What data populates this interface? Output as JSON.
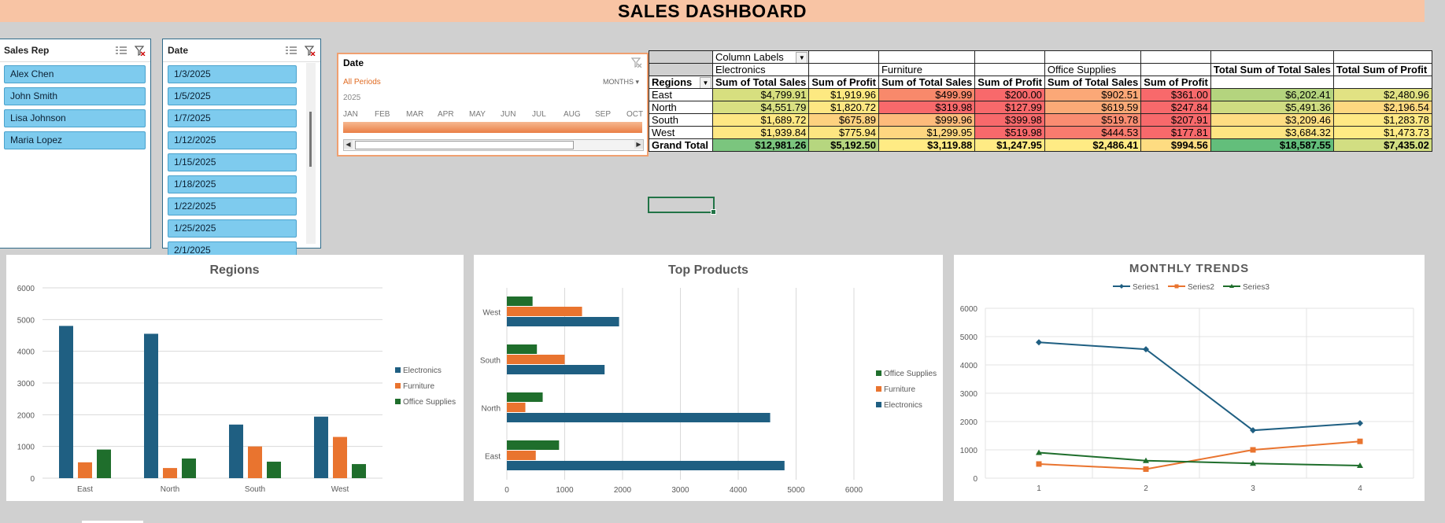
{
  "dashboard": {
    "title": "SALES DASHBOARD"
  },
  "slicers": {
    "sales_rep": {
      "title": "Sales Rep",
      "items": [
        "Alex Chen",
        "John Smith",
        "Lisa Johnson",
        "Maria Lopez"
      ]
    },
    "date": {
      "title": "Date",
      "items": [
        "1/3/2025",
        "1/5/2025",
        "1/7/2025",
        "1/12/2025",
        "1/15/2025",
        "1/18/2025",
        "1/22/2025",
        "1/25/2025",
        "2/1/2025"
      ]
    }
  },
  "timeline": {
    "title": "Date",
    "all_periods": "All Periods",
    "level": "MONTHS",
    "year": "2025",
    "months": [
      "JAN",
      "FEB",
      "MAR",
      "APR",
      "MAY",
      "JUN",
      "JUL",
      "AUG",
      "SEP",
      "OCT"
    ]
  },
  "pivot": {
    "column_labels": "Column Labels",
    "categories": [
      "Electronics",
      "Furniture",
      "Office Supplies"
    ],
    "total_sales_header": "Total Sum of Total Sales",
    "total_profit_header": "Total Sum of Profit",
    "measure_sales": "Sum of Total Sales",
    "measure_profit": "Sum of Profit",
    "row_label": "Regions",
    "rows": [
      {
        "region": "East",
        "cells": [
          "$4,799.91",
          "$1,919.96",
          "$499.99",
          "$200.00",
          "$902.51",
          "$361.00",
          "$6,202.41",
          "$2,480.96"
        ]
      },
      {
        "region": "North",
        "cells": [
          "$4,551.79",
          "$1,820.72",
          "$319.98",
          "$127.99",
          "$619.59",
          "$247.84",
          "$5,491.36",
          "$2,196.54"
        ]
      },
      {
        "region": "South",
        "cells": [
          "$1,689.72",
          "$675.89",
          "$999.96",
          "$399.98",
          "$519.78",
          "$207.91",
          "$3,209.46",
          "$1,283.78"
        ]
      },
      {
        "region": "West",
        "cells": [
          "$1,939.84",
          "$775.94",
          "$1,299.95",
          "$519.98",
          "$444.53",
          "$177.81",
          "$3,684.32",
          "$1,473.73"
        ]
      }
    ],
    "grand_total": {
      "region": "Grand Total",
      "cells": [
        "$12,981.26",
        "$5,192.50",
        "$3,119.88",
        "$1,247.95",
        "$2,486.41",
        "$994.56",
        "$18,587.55",
        "$7,435.02"
      ]
    },
    "heat_colors": {
      "East": [
        "#d7df7f",
        "#fde981",
        "#f8896b",
        "#f8696b",
        "#fba877",
        "#f8696b",
        "#b4d47e",
        "#e1e283"
      ],
      "North": [
        "#d9e082",
        "#fee783",
        "#f8696b",
        "#f8696b",
        "#fbaa77",
        "#f8696b",
        "#cfdc81",
        "#fed880"
      ],
      "South": [
        "#fee783",
        "#fdd17f",
        "#fdbb7b",
        "#f8696b",
        "#fa8c71",
        "#f8696b",
        "#fedd82",
        "#ffe984"
      ],
      "West": [
        "#fee783",
        "#fde581",
        "#fed680",
        "#f8696b",
        "#f97b6e",
        "#f8696b",
        "#fee582",
        "#ffeb84"
      ],
      "Grand Total": [
        "#7bc57e",
        "#b6d67f",
        "#ffeb84",
        "#ffeb84",
        "#ffeb84",
        "#fedc81",
        "#63be7b",
        "#d2de82"
      ]
    }
  },
  "charts": {
    "regions": {
      "title": "Regions",
      "chart_data": {
        "type": "bar",
        "categories": [
          "East",
          "North",
          "South",
          "West"
        ],
        "series": [
          {
            "name": "Electronics",
            "values": [
              4799.91,
              4551.79,
              1689.72,
              1939.84
            ],
            "color": "#1f5f82"
          },
          {
            "name": "Furniture",
            "values": [
              499.99,
              319.98,
              999.96,
              1299.95
            ],
            "color": "#e9742f"
          },
          {
            "name": "Office Supplies",
            "values": [
              902.51,
              619.59,
              519.78,
              444.53
            ],
            "color": "#1f6e2c"
          }
        ],
        "ylim": [
          0,
          6000
        ],
        "yticks": [
          "0",
          "1000",
          "2000",
          "3000",
          "4000",
          "5000",
          "6000"
        ],
        "legend": "right",
        "grid": true
      }
    },
    "top_products": {
      "title": "Top Products",
      "chart_data": {
        "type": "bar",
        "orientation": "horizontal",
        "categories": [
          "East",
          "North",
          "South",
          "West"
        ],
        "series": [
          {
            "name": "Electronics",
            "values": [
              4799.91,
              4551.79,
              1689.72,
              1939.84
            ],
            "color": "#1f5f82"
          },
          {
            "name": "Furniture",
            "values": [
              499.99,
              319.98,
              999.96,
              1299.95
            ],
            "color": "#e9742f"
          },
          {
            "name": "Office Supplies",
            "values": [
              902.51,
              619.59,
              519.78,
              444.53
            ],
            "color": "#1f6e2c"
          }
        ],
        "legend_order": [
          "Office Supplies",
          "Furniture",
          "Electronics"
        ],
        "xlim": [
          0,
          6000
        ],
        "xticks": [
          "0",
          "1000",
          "2000",
          "3000",
          "4000",
          "5000",
          "6000"
        ],
        "legend": "right",
        "grid": true
      }
    },
    "monthly_trends": {
      "title": "MONTHLY TRENDS",
      "chart_data": {
        "type": "line",
        "x": [
          "1",
          "2",
          "3",
          "4"
        ],
        "series": [
          {
            "name": "Series1",
            "values": [
              4799.91,
              4551.79,
              1689.72,
              1939.84
            ],
            "color": "#1f5f82",
            "marker": "diamond"
          },
          {
            "name": "Series2",
            "values": [
              499.99,
              319.98,
              999.96,
              1299.95
            ],
            "color": "#e9742f",
            "marker": "square"
          },
          {
            "name": "Series3",
            "values": [
              902.51,
              619.59,
              519.78,
              444.53
            ],
            "color": "#1f6e2c",
            "marker": "triangle"
          }
        ],
        "ylim": [
          0,
          6000
        ],
        "yticks": [
          "0",
          "1000",
          "2000",
          "3000",
          "4000",
          "5000",
          "6000"
        ],
        "legend": "top",
        "grid": true
      }
    }
  }
}
